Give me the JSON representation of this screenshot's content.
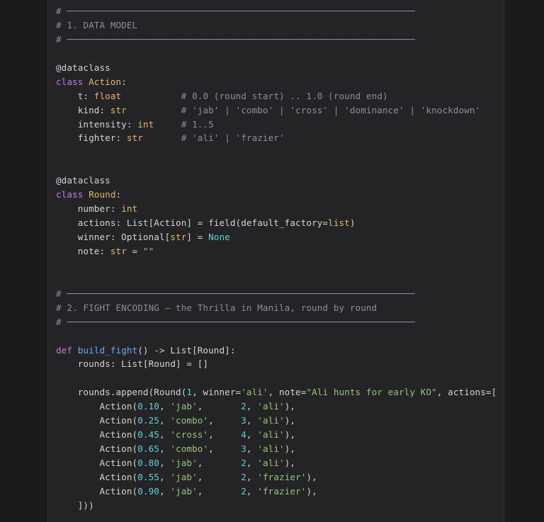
{
  "colors": {
    "background": "#1b1b1d",
    "panel": "#242427",
    "text": "#d4d4d4",
    "comment": "#8b8f98",
    "keyword": "#c678dd",
    "class_type": "#e5b567",
    "function": "#6fa8ff",
    "number": "#5fd0d6",
    "string": "#98c379"
  },
  "editor": {
    "lines": [
      [
        {
          "t": "# ────────────────────────────────────────────────────────────────",
          "c": "com"
        }
      ],
      [
        {
          "t": "# 1. DATA MODEL",
          "c": "com"
        }
      ],
      [
        {
          "t": "# ────────────────────────────────────────────────────────────────",
          "c": "com"
        }
      ],
      [],
      [
        {
          "t": "@dataclass"
        }
      ],
      [
        {
          "t": "class ",
          "c": "kw"
        },
        {
          "t": "Action",
          "c": "cls"
        },
        {
          "t": ":"
        }
      ],
      [
        {
          "t": "    t: "
        },
        {
          "t": "float",
          "c": "typ"
        },
        {
          "t": "           "
        },
        {
          "t": "# 0.0 (round start) .. 1.0 (round end)",
          "c": "com"
        }
      ],
      [
        {
          "t": "    kind: "
        },
        {
          "t": "str",
          "c": "typ"
        },
        {
          "t": "          "
        },
        {
          "t": "# 'jab' | 'combo' | 'cross' | 'dominance' | 'knockdown'",
          "c": "com"
        }
      ],
      [
        {
          "t": "    intensity: "
        },
        {
          "t": "int",
          "c": "typ"
        },
        {
          "t": "     "
        },
        {
          "t": "# 1..5",
          "c": "com"
        }
      ],
      [
        {
          "t": "    fighter: "
        },
        {
          "t": "str",
          "c": "typ"
        },
        {
          "t": "       "
        },
        {
          "t": "# 'ali' | 'frazier'",
          "c": "com"
        }
      ],
      [],
      [],
      [
        {
          "t": "@dataclass"
        }
      ],
      [
        {
          "t": "class ",
          "c": "kw"
        },
        {
          "t": "Round",
          "c": "cls"
        },
        {
          "t": ":"
        }
      ],
      [
        {
          "t": "    number: "
        },
        {
          "t": "int",
          "c": "typ"
        }
      ],
      [
        {
          "t": "    actions: List[Action] = field(default_factory="
        },
        {
          "t": "list",
          "c": "typ"
        },
        {
          "t": ")"
        }
      ],
      [
        {
          "t": "    winner: Optional["
        },
        {
          "t": "str",
          "c": "typ"
        },
        {
          "t": "] = "
        },
        {
          "t": "None",
          "c": "cst"
        }
      ],
      [
        {
          "t": "    note: "
        },
        {
          "t": "str",
          "c": "typ"
        },
        {
          "t": " = "
        },
        {
          "t": "\"\"",
          "c": "str"
        }
      ],
      [],
      [],
      [
        {
          "t": "# ────────────────────────────────────────────────────────────────",
          "c": "com"
        }
      ],
      [
        {
          "t": "# 2. FIGHT ENCODING — the Thrilla in Manila, round by round",
          "c": "com"
        }
      ],
      [
        {
          "t": "# ────────────────────────────────────────────────────────────────",
          "c": "com"
        }
      ],
      [],
      [
        {
          "t": "def ",
          "c": "kw"
        },
        {
          "t": "build_fight",
          "c": "fn"
        },
        {
          "t": "() -> List[Round]:"
        }
      ],
      [
        {
          "t": "    rounds: List[Round] = []"
        }
      ],
      [],
      [
        {
          "t": "    rounds.append(Round("
        },
        {
          "t": "1",
          "c": "num"
        },
        {
          "t": ", winner="
        },
        {
          "t": "'ali'",
          "c": "str"
        },
        {
          "t": ", note="
        },
        {
          "t": "\"Ali hunts for early KO\"",
          "c": "str"
        },
        {
          "t": ", actions=["
        }
      ],
      [
        {
          "t": "        Action("
        },
        {
          "t": "0.10",
          "c": "num"
        },
        {
          "t": ", "
        },
        {
          "t": "'jab'",
          "c": "str"
        },
        {
          "t": ",       "
        },
        {
          "t": "2",
          "c": "num"
        },
        {
          "t": ", "
        },
        {
          "t": "'ali'",
          "c": "str"
        },
        {
          "t": "),"
        }
      ],
      [
        {
          "t": "        Action("
        },
        {
          "t": "0.25",
          "c": "num"
        },
        {
          "t": ", "
        },
        {
          "t": "'combo'",
          "c": "str"
        },
        {
          "t": ",     "
        },
        {
          "t": "3",
          "c": "num"
        },
        {
          "t": ", "
        },
        {
          "t": "'ali'",
          "c": "str"
        },
        {
          "t": "),"
        }
      ],
      [
        {
          "t": "        Action("
        },
        {
          "t": "0.45",
          "c": "num"
        },
        {
          "t": ", "
        },
        {
          "t": "'cross'",
          "c": "str"
        },
        {
          "t": ",     "
        },
        {
          "t": "4",
          "c": "num"
        },
        {
          "t": ", "
        },
        {
          "t": "'ali'",
          "c": "str"
        },
        {
          "t": "),"
        }
      ],
      [
        {
          "t": "        Action("
        },
        {
          "t": "0.65",
          "c": "num"
        },
        {
          "t": ", "
        },
        {
          "t": "'combo'",
          "c": "str"
        },
        {
          "t": ",     "
        },
        {
          "t": "3",
          "c": "num"
        },
        {
          "t": ", "
        },
        {
          "t": "'ali'",
          "c": "str"
        },
        {
          "t": "),"
        }
      ],
      [
        {
          "t": "        Action("
        },
        {
          "t": "0.80",
          "c": "num"
        },
        {
          "t": ", "
        },
        {
          "t": "'jab'",
          "c": "str"
        },
        {
          "t": ",       "
        },
        {
          "t": "2",
          "c": "num"
        },
        {
          "t": ", "
        },
        {
          "t": "'ali'",
          "c": "str"
        },
        {
          "t": "),"
        }
      ],
      [
        {
          "t": "        Action("
        },
        {
          "t": "0.55",
          "c": "num"
        },
        {
          "t": ", "
        },
        {
          "t": "'jab'",
          "c": "str"
        },
        {
          "t": ",       "
        },
        {
          "t": "2",
          "c": "num"
        },
        {
          "t": ", "
        },
        {
          "t": "'frazier'",
          "c": "str"
        },
        {
          "t": "),"
        }
      ],
      [
        {
          "t": "        Action("
        },
        {
          "t": "0.90",
          "c": "num"
        },
        {
          "t": ", "
        },
        {
          "t": "'jab'",
          "c": "str"
        },
        {
          "t": ",       "
        },
        {
          "t": "2",
          "c": "num"
        },
        {
          "t": ", "
        },
        {
          "t": "'frazier'",
          "c": "str"
        },
        {
          "t": "),"
        }
      ],
      [
        {
          "t": "    ]))"
        }
      ]
    ]
  }
}
